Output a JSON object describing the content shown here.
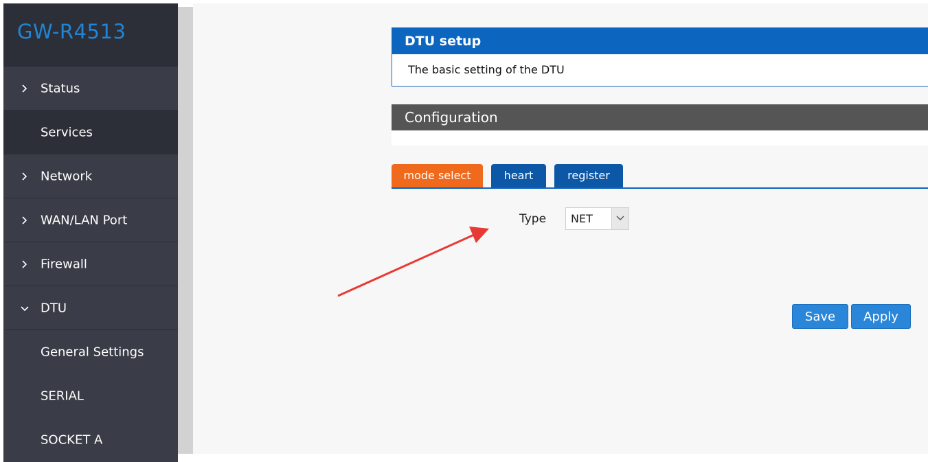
{
  "app": {
    "brand": "GW-R4513"
  },
  "sidebar": {
    "items": [
      {
        "label": "Status",
        "chevron": "right",
        "active": false
      },
      {
        "label": "Services",
        "chevron": "none",
        "active": true
      },
      {
        "label": "Network",
        "chevron": "right",
        "active": false
      },
      {
        "label": "WAN/LAN Port",
        "chevron": "right",
        "active": false
      },
      {
        "label": "Firewall",
        "chevron": "right",
        "active": false
      },
      {
        "label": "DTU",
        "chevron": "down",
        "active": false
      },
      {
        "label": "General Settings",
        "chevron": "none",
        "active": false
      },
      {
        "label": "SERIAL",
        "chevron": "none",
        "active": false
      },
      {
        "label": "SOCKET A",
        "chevron": "none",
        "active": false
      }
    ]
  },
  "main": {
    "dtu_title": "DTU setup",
    "dtu_description": "The basic setting of the DTU",
    "config_title": "Configuration",
    "tabs": [
      {
        "label": "mode select",
        "active": true
      },
      {
        "label": "heart",
        "active": false
      },
      {
        "label": "register",
        "active": false
      }
    ],
    "type_field": {
      "label": "Type",
      "value": "NET"
    },
    "buttons": {
      "save": "Save",
      "apply": "Apply"
    }
  },
  "colors": {
    "sidebar_bg": "#3a3d47",
    "brand_color": "#1f86d6",
    "header_blue": "#0c65be",
    "tab_active": "#f06a1e",
    "tab_inactive": "#0c57a6",
    "button_blue": "#2a86d8",
    "annotation_arrow": "#e83a35"
  },
  "icons": {
    "chevron_right": "chevron-right-icon",
    "chevron_down": "chevron-down-icon",
    "select_caret": "caret-down-icon",
    "annotation": "red-arrow-annotation"
  }
}
